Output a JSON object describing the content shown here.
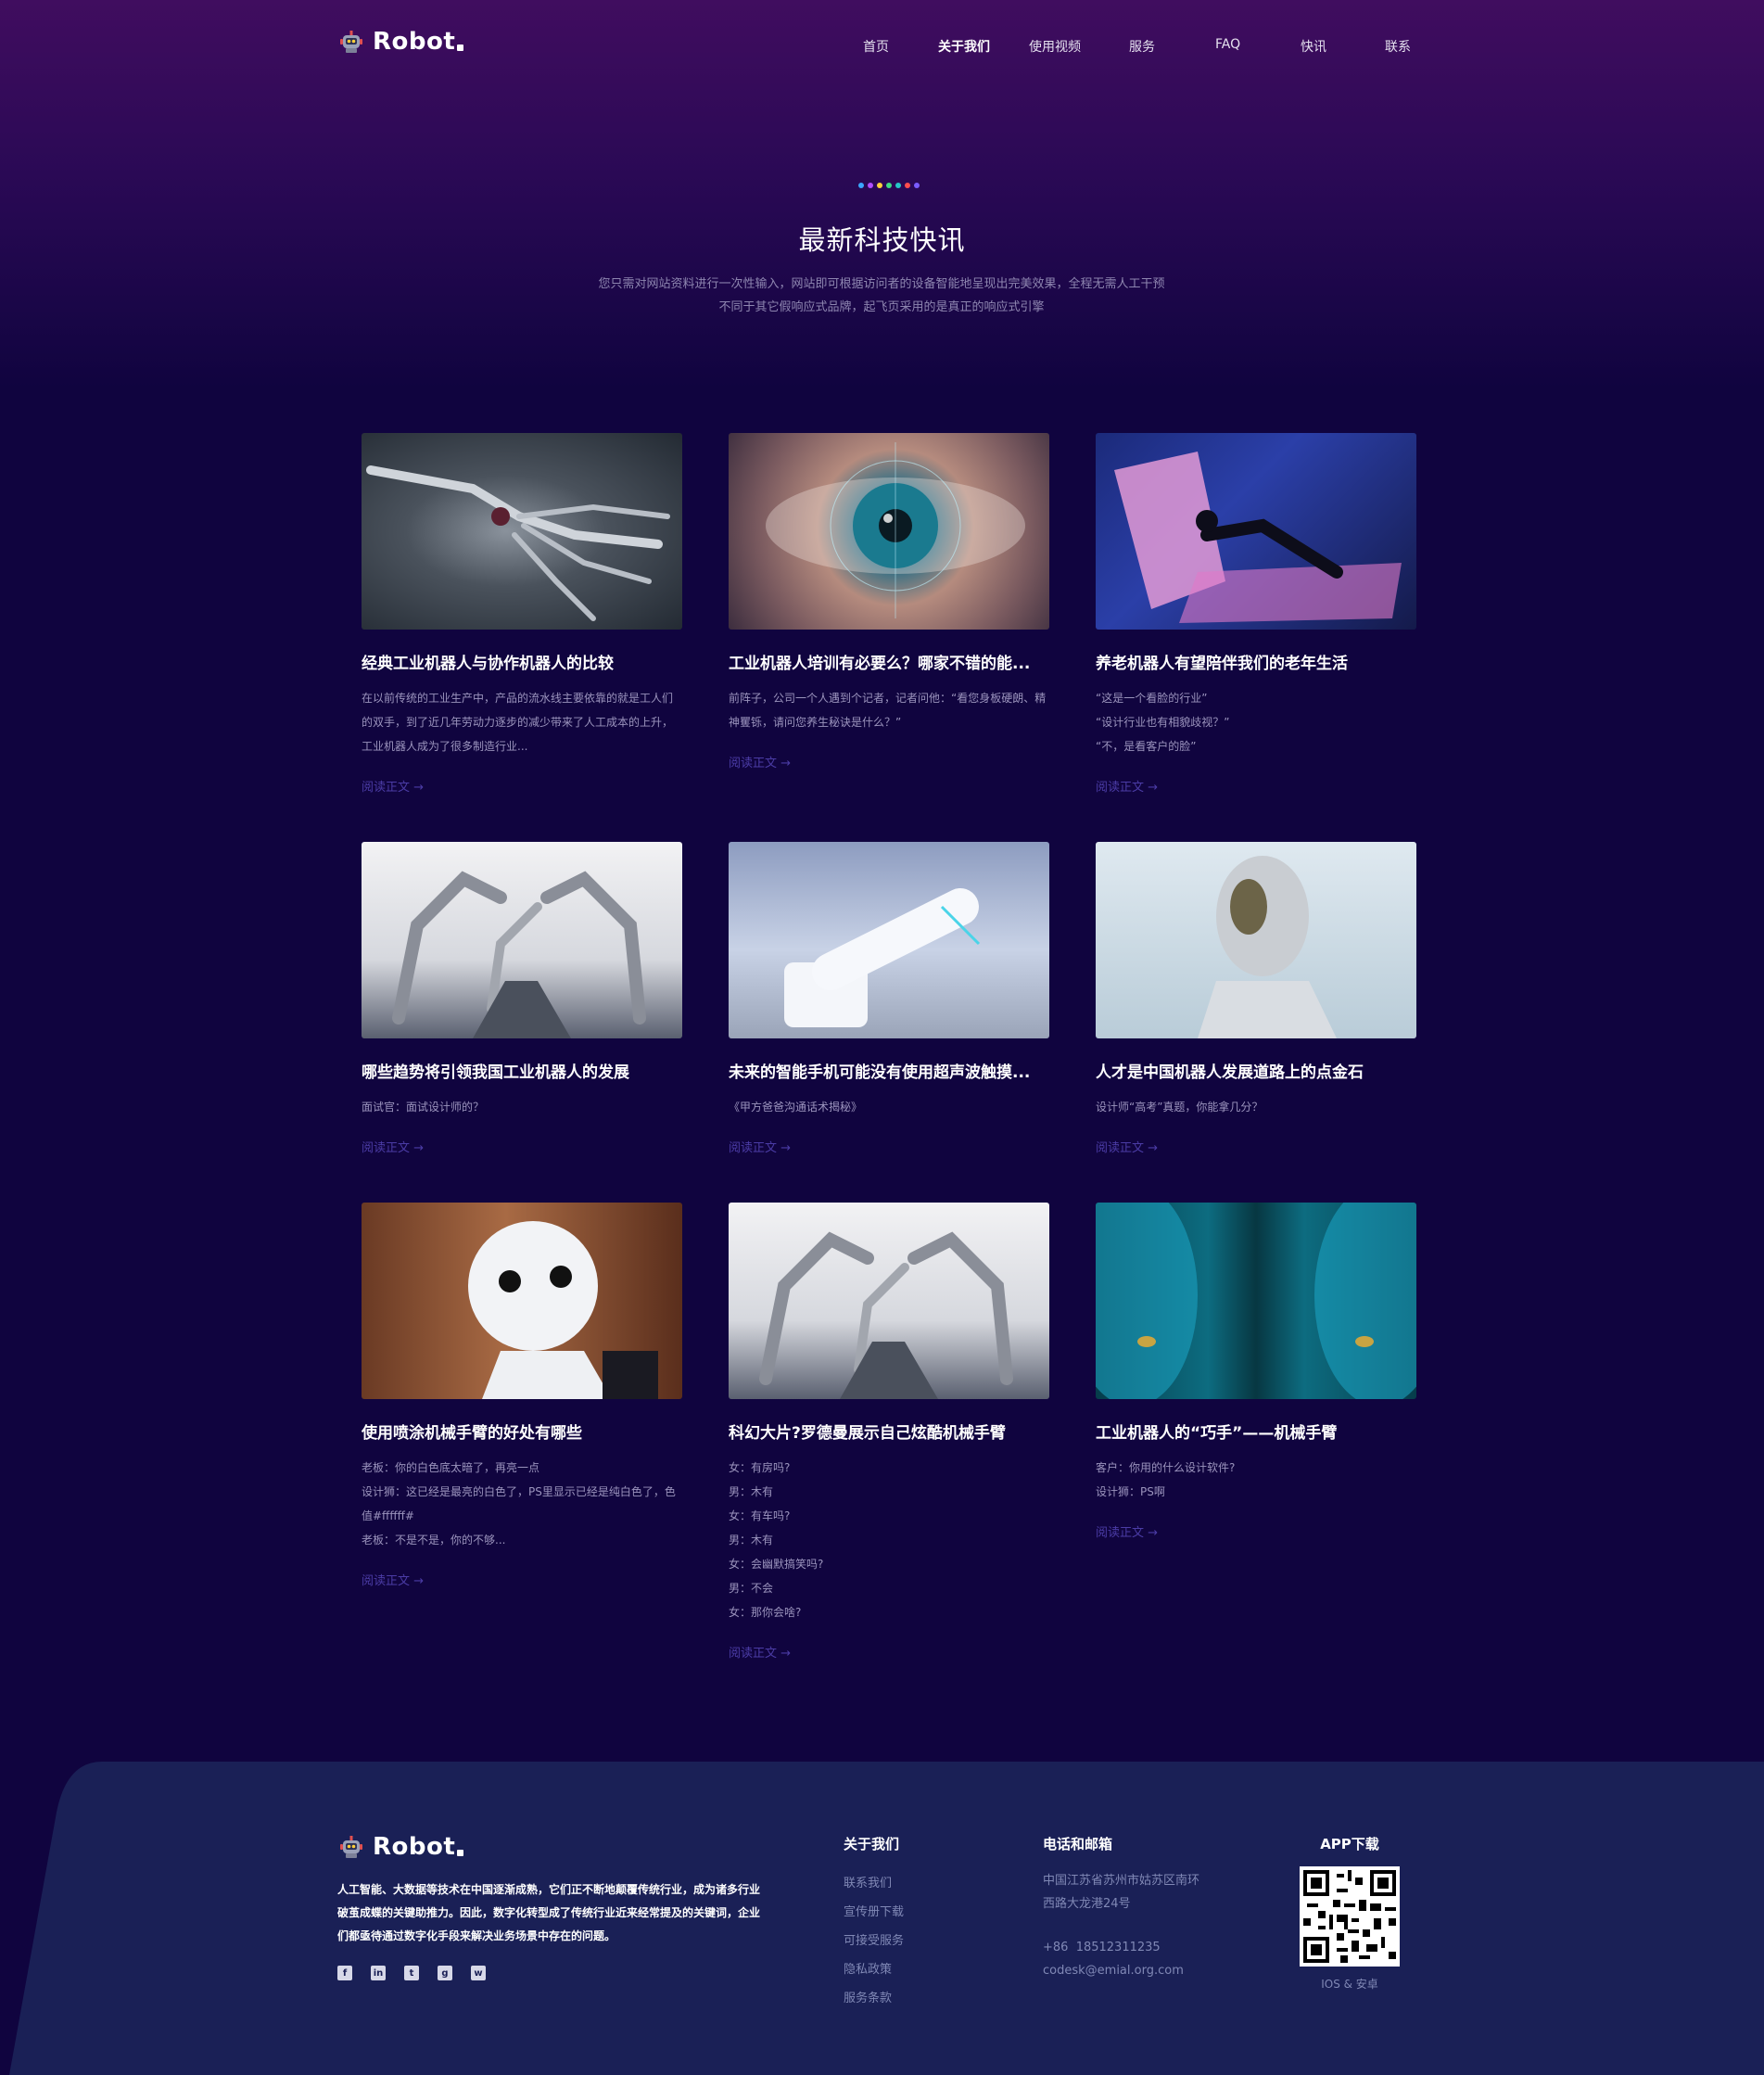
{
  "header": {
    "logo_text": "Robot",
    "nav": [
      {
        "label": "首页",
        "active": false
      },
      {
        "label": "关于我们",
        "active": true
      },
      {
        "label": "使用视频",
        "active": false
      },
      {
        "label": "服务",
        "active": false
      },
      {
        "label": "FAQ",
        "active": false
      },
      {
        "label": "快讯",
        "active": false
      },
      {
        "label": "联系",
        "active": false
      }
    ]
  },
  "section": {
    "dot_colors": [
      "#3aa7ff",
      "#b04dff",
      "#ffd23a",
      "#3ddc84",
      "#25c6c6",
      "#ff4d4d",
      "#7a5cff"
    ],
    "title": "最新科技快讯",
    "subtitle_1": "您只需对网站资料进行一次性输入，网站即可根据访问者的设备智能地呈现出完美效果，全程无需人工干预",
    "subtitle_2": "不同于其它假响应式品牌，起飞页采用的是真正的响应式引擎"
  },
  "cards": [
    {
      "title": "经典工业机器人与协作机器人的比较",
      "lines": [
        "在以前传统的工业生产中，产品的流水线主要依靠的就是工人们",
        "的双手，到了近几年劳动力逐步的减少带来了人工成本的上升，",
        "工业机器人成为了很多制造行业..."
      ],
      "more": "阅读正文 →"
    },
    {
      "title": "工业机器人培训有必要么？哪家不错的能...",
      "lines": [
        "前阵子，公司一个人遇到个记者，记者问他：“看您身板硬朗、精",
        "神矍铄，请问您养生秘诀是什么？”"
      ],
      "more": "阅读正文 →"
    },
    {
      "title": "养老机器人有望陪伴我们的老年生活",
      "lines": [
        "“这是一个看脸的行业”",
        "“设计行业也有相貌歧视？”",
        "“不，是看客户的脸”"
      ],
      "more": "阅读正文 →"
    },
    {
      "title": "哪些趋势将引领我国工业机器人的发展",
      "lines": [
        "面试官：面试设计师的？"
      ],
      "more": "阅读正文 →"
    },
    {
      "title": "未来的智能手机可能没有使用超声波触摸...",
      "lines": [
        "《甲方爸爸沟通话术揭秘》"
      ],
      "more": "阅读正文 →"
    },
    {
      "title": "人才是中国机器人发展道路上的点金石",
      "lines": [
        "设计师“高考”真题，你能拿几分？"
      ],
      "more": "阅读正文 →"
    },
    {
      "title": "使用喷涂机械手臂的好处有哪些",
      "lines": [
        "老板：你的白色底太暗了，再亮一点",
        "设计狮：这已经是最亮的白色了，PS里显示已经是纯白色了，色",
        "值#ffffff#",
        "老板：不是不是，你的不够..."
      ],
      "more": "阅读正文 →"
    },
    {
      "title": "科幻大片?罗德曼展示自己炫酷机械手臂",
      "lines": [
        "女：有房吗?",
        "男：木有",
        "女：有车吗?",
        "男：木有",
        "女：会幽默搞笑吗?",
        "男：不会",
        "女：那你会啥?"
      ],
      "more": "阅读正文 →"
    },
    {
      "title": "工业机器人的“巧手”——机械手臂",
      "lines": [
        "客户：你用的什么设计软件?",
        "设计狮：PS啊"
      ],
      "more": "阅读正文 →"
    }
  ],
  "footer": {
    "logo_text": "Robot",
    "about": "人工智能、大数据等技术在中国逐渐成熟，它们正不断地颠覆传统行业，成为诸多行业破茧成蝶的关键助推力。因此，数字化转型成了传统行业近来经常提及的关键词，企业们都亟待通过数字化手段来解决业务场景中存在的问题。",
    "socials": [
      "f",
      "in",
      "t",
      "g",
      "w"
    ],
    "col1": {
      "title": "关于我们",
      "links": [
        "联系我们",
        "宣传册下载",
        "可接受服务",
        "隐私政策",
        "服务条款"
      ]
    },
    "col2": {
      "title": "电话和邮箱",
      "address_1": "中国江苏省苏州市姑苏区南环",
      "address_2": "西路大龙港24号",
      "phone": "+86  18512311235",
      "email": "codesk@emial.org.com"
    },
    "col3": {
      "title": "APP下载",
      "caption": "IOS & 安卓"
    }
  }
}
